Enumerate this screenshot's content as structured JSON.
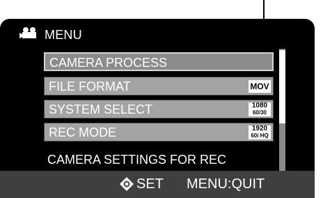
{
  "menu": {
    "title": "MENU",
    "items": [
      {
        "label": "CAMERA PROCESS",
        "selected": true
      },
      {
        "label": "FILE FORMAT",
        "badge": "MOV"
      },
      {
        "label": "SYSTEM SELECT",
        "badge_top": "1080",
        "badge_bottom": "60/30"
      },
      {
        "label": "REC MODE",
        "badge_top": "1920",
        "badge_bottom": "60i HQ"
      }
    ],
    "description": "CAMERA SETTINGS FOR REC"
  },
  "footer": {
    "set_label": "SET",
    "quit_label": "MENU:QUIT"
  },
  "icons": {
    "menu_icon": "video-camera-icon",
    "set_icon": "joystick-icon"
  }
}
